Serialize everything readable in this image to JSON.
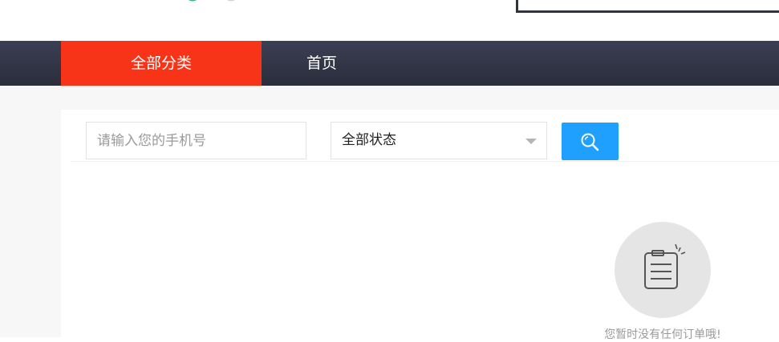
{
  "navbar": {
    "items": [
      {
        "label": "全部分类"
      },
      {
        "label": "首页"
      }
    ]
  },
  "filters": {
    "phone_placeholder": "请输入您的手机号",
    "status_selected": "全部状态"
  },
  "icons": {
    "search": "search-icon",
    "caret": "chevron-down-icon",
    "empty": "clipboard-icon"
  },
  "empty_state": {
    "message": "您暂时没有任何订单哦!"
  },
  "colors": {
    "accent_red": "#f73418",
    "nav_bg": "#33374a",
    "search_blue": "#1fa0ff"
  }
}
